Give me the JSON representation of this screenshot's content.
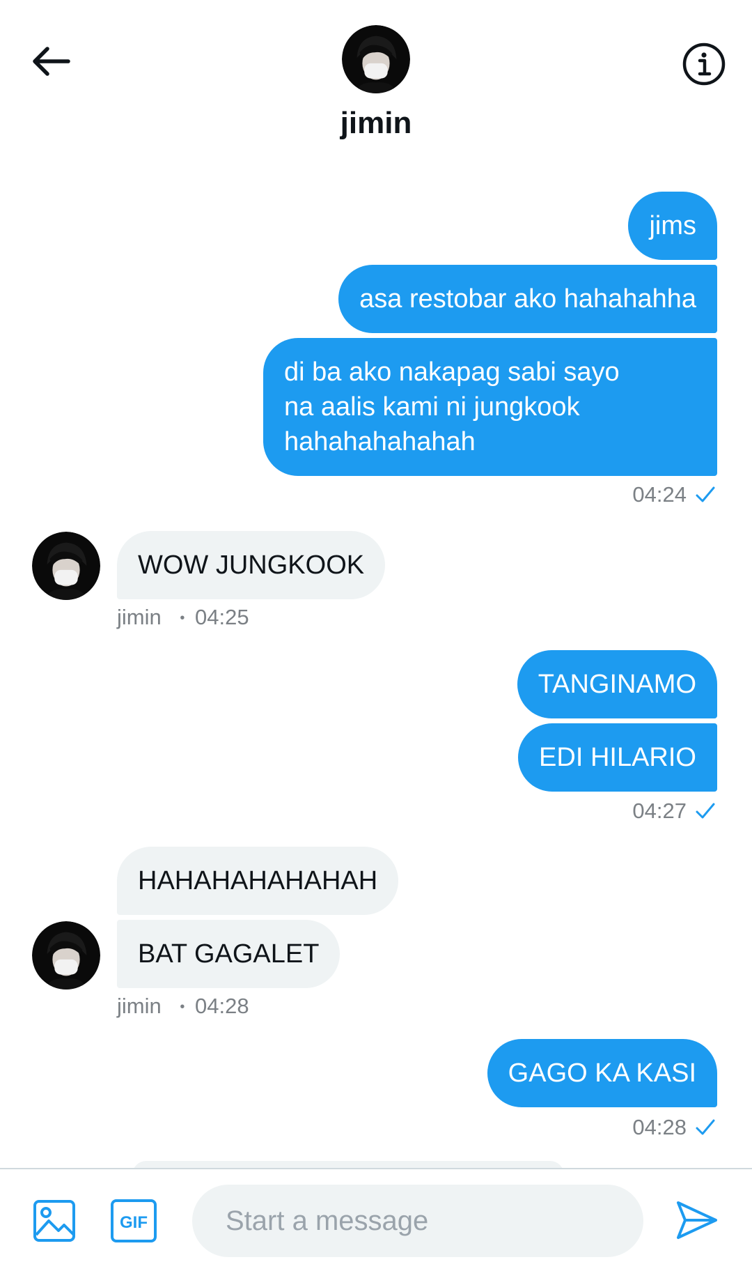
{
  "header": {
    "contact_name": "jimin"
  },
  "messages": [
    {
      "direction": "out",
      "text": "jims"
    },
    {
      "direction": "out",
      "text": "asa restobar ako hahahahha"
    },
    {
      "direction": "out",
      "text": "di ba ako nakapag sabi sayo\nna aalis kami ni jungkook\nhahahahahahah"
    },
    {
      "direction": "out-meta",
      "time": "04:24"
    },
    {
      "direction": "in",
      "text": "WOW JUNGKOOK"
    },
    {
      "direction": "in-meta",
      "sender": "jimin",
      "time": "04:25"
    },
    {
      "direction": "out",
      "text": "TANGINAMO"
    },
    {
      "direction": "out",
      "text": "EDI HILARIO"
    },
    {
      "direction": "out-meta",
      "time": "04:27"
    },
    {
      "direction": "in",
      "text": "HAHAHAHAHAHAH"
    },
    {
      "direction": "in",
      "text": "BAT GAGALET"
    },
    {
      "direction": "in-meta",
      "sender": "jimin",
      "time": "04:28"
    },
    {
      "direction": "out",
      "text": "GAGO KA KASI"
    },
    {
      "direction": "out-meta",
      "time": "04:28"
    }
  ],
  "bubbles": {
    "b1": "jims",
    "b2": "asa restobar ako hahahahha",
    "b3": "di ba ako nakapag sabi sayo\nna aalis kami ni jungkook\nhahahahahahah",
    "b4": "WOW JUNGKOOK",
    "b5": "TANGINAMO",
    "b6": "EDI HILARIO",
    "b7": "HAHAHAHAHAHAH",
    "b8": "BAT GAGALET",
    "b9": "GAGO KA KASI"
  },
  "meta": {
    "m1_time": "04:24",
    "m2_sender": "jimin",
    "m2_sep": "•",
    "m2_time": "04:25",
    "m3_time": "04:27",
    "m4_sender": "jimin",
    "m4_sep": "•",
    "m4_time": "04:28",
    "m5_time": "04:28"
  },
  "composer": {
    "placeholder": "Start a message",
    "gif_label": "GIF"
  },
  "icons": {
    "back": "arrow-left-icon",
    "info": "info-icon",
    "media": "image-icon",
    "gif": "gif-icon",
    "send": "send-icon",
    "read": "check-icon"
  },
  "colors": {
    "accent": "#1d9bf0",
    "incoming_bubble": "#eff3f4",
    "meta_text": "#7b8085"
  }
}
